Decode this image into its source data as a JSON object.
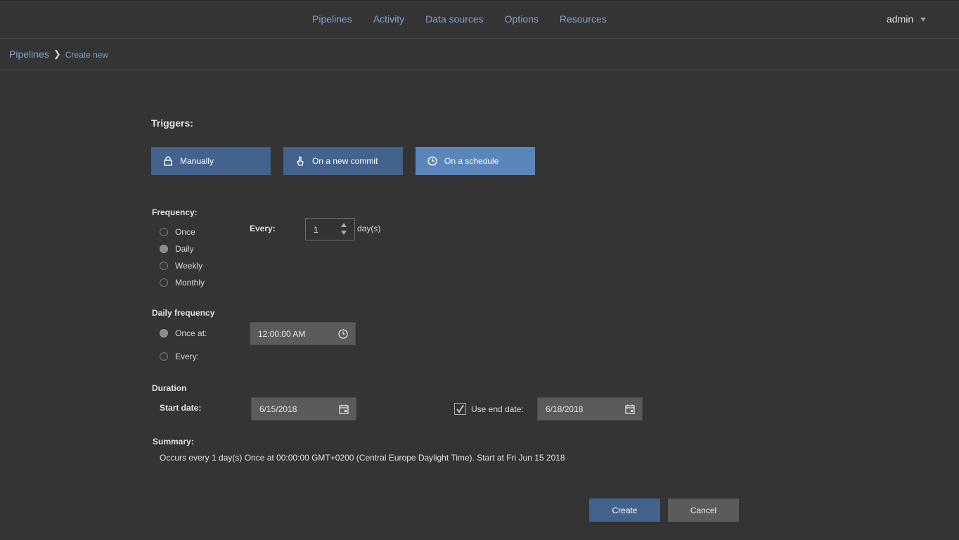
{
  "nav": {
    "items": [
      "Pipelines",
      "Activity",
      "Data sources",
      "Options",
      "Resources"
    ],
    "user": "admin"
  },
  "breadcrumb": {
    "root": "Pipelines",
    "current": "Create new"
  },
  "triggers": {
    "label": "Triggers:",
    "manually": "Manually",
    "on_commit": "On a new commit",
    "on_schedule": "On a schedule",
    "active": "On a schedule"
  },
  "frequency": {
    "label": "Frequency:",
    "options": [
      "Once",
      "Daily",
      "Weekly",
      "Monthly"
    ],
    "selected": "Daily",
    "every_label": "Every:",
    "every_value": "1",
    "unit": "day(s)"
  },
  "daily_frequency": {
    "label": "Daily frequency",
    "once_at_label": "Once at:",
    "every_label": "Every:",
    "selected": "Once at:",
    "time_value": "12:00:00 AM"
  },
  "duration": {
    "label": "Duration",
    "start_label": "Start date:",
    "start_value": "6/15/2018",
    "use_end_label": "Use end date:",
    "use_end_checked": true,
    "end_value": "6/18/2018"
  },
  "summary": {
    "label": "Summary:",
    "text": "Occurs every 1 day(s) Once at 00:00:00 GMT+0200 (Central Europe Daylight Time). Start at Fri Jun 15 2018"
  },
  "actions": {
    "create": "Create",
    "cancel": "Cancel"
  },
  "colors": {
    "background": "#343434",
    "accent": "#43628c",
    "accent_active": "#5a86ba",
    "link": "#7fa3c9"
  }
}
